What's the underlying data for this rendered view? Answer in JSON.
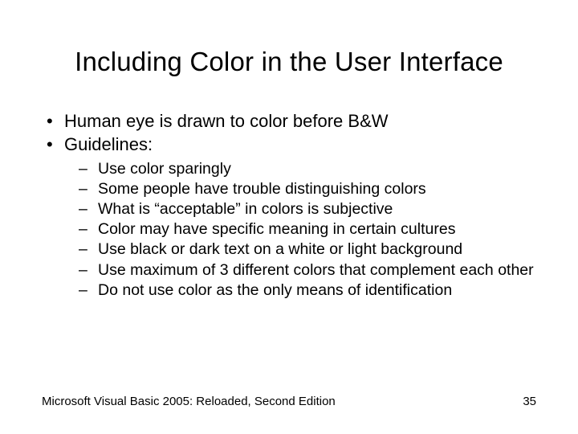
{
  "title": "Including Color in the User Interface",
  "bullets": {
    "b0": "Human eye is drawn to color before B&W",
    "b1": "Guidelines:"
  },
  "sub": {
    "s0": "Use color sparingly",
    "s1": "Some people have trouble distinguishing colors",
    "s2": "What is “acceptable” in colors is subjective",
    "s3": "Color may have specific meaning in certain cultures",
    "s4": "Use black or dark text on a white or light background",
    "s5": "Use maximum of 3 different colors that complement each other",
    "s6": "Do not use color as the only means of identification"
  },
  "footer": {
    "source": "Microsoft Visual Basic 2005: Reloaded, Second Edition",
    "page": "35"
  }
}
